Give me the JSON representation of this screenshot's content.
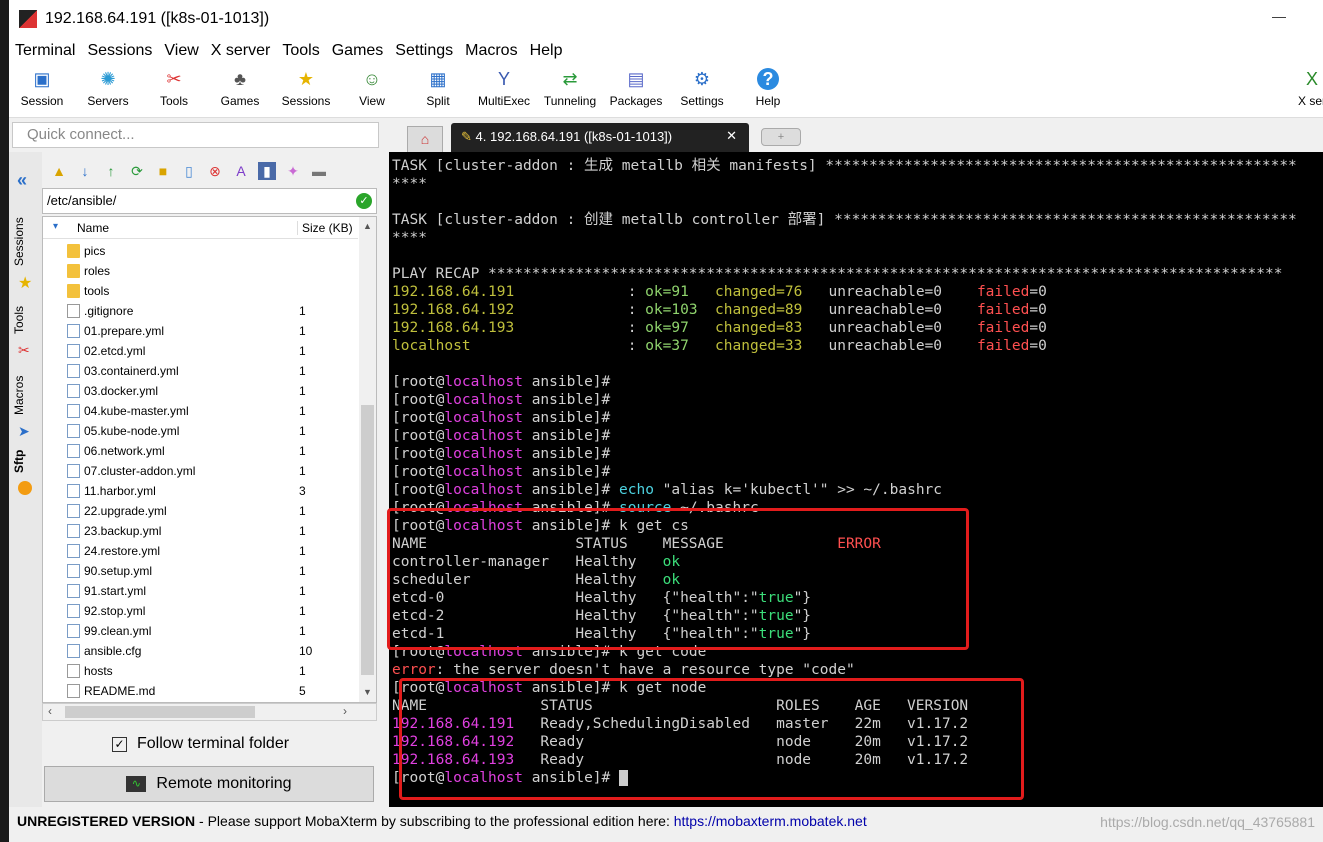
{
  "window": {
    "title": "192.168.64.191 ([k8s-01-1013])",
    "minimize": "—"
  },
  "menu": [
    "Terminal",
    "Sessions",
    "View",
    "X server",
    "Tools",
    "Games",
    "Settings",
    "Macros",
    "Help"
  ],
  "toolbar": [
    {
      "label": "Session",
      "icon": "session-icon"
    },
    {
      "label": "Servers",
      "icon": "servers-icon"
    },
    {
      "label": "Tools",
      "icon": "tools-icon"
    },
    {
      "label": "Games",
      "icon": "games-icon"
    },
    {
      "label": "Sessions",
      "icon": "star-icon"
    },
    {
      "label": "View",
      "icon": "view-icon"
    },
    {
      "label": "Split",
      "icon": "split-icon"
    },
    {
      "label": "MultiExec",
      "icon": "multiexec-icon"
    },
    {
      "label": "Tunneling",
      "icon": "tunneling-icon"
    },
    {
      "label": "Packages",
      "icon": "packages-icon"
    },
    {
      "label": "Settings",
      "icon": "settings-icon"
    },
    {
      "label": "Help",
      "icon": "help-icon"
    },
    {
      "label": "X ser",
      "icon": "xserver-icon"
    }
  ],
  "quick_connect": {
    "placeholder": "Quick connect..."
  },
  "tabs": {
    "active": "4. 192.168.64.191 ([k8s-01-1013])"
  },
  "side_tabs": [
    "Sessions",
    "Tools",
    "Macros",
    "Sftp"
  ],
  "sftp": {
    "path": "/etc/ansible/",
    "col_name": "Name",
    "col_size": "Size (KB)",
    "files": [
      {
        "name": "pics",
        "size": "",
        "type": "folder"
      },
      {
        "name": "roles",
        "size": "",
        "type": "folder"
      },
      {
        "name": "tools",
        "size": "",
        "type": "folder"
      },
      {
        "name": ".gitignore",
        "size": "1",
        "type": "file"
      },
      {
        "name": "01.prepare.yml",
        "size": "1",
        "type": "yml"
      },
      {
        "name": "02.etcd.yml",
        "size": "1",
        "type": "yml"
      },
      {
        "name": "03.containerd.yml",
        "size": "1",
        "type": "yml"
      },
      {
        "name": "03.docker.yml",
        "size": "1",
        "type": "yml"
      },
      {
        "name": "04.kube-master.yml",
        "size": "1",
        "type": "yml"
      },
      {
        "name": "05.kube-node.yml",
        "size": "1",
        "type": "yml"
      },
      {
        "name": "06.network.yml",
        "size": "1",
        "type": "yml"
      },
      {
        "name": "07.cluster-addon.yml",
        "size": "1",
        "type": "yml"
      },
      {
        "name": "11.harbor.yml",
        "size": "3",
        "type": "yml"
      },
      {
        "name": "22.upgrade.yml",
        "size": "1",
        "type": "yml"
      },
      {
        "name": "23.backup.yml",
        "size": "1",
        "type": "yml"
      },
      {
        "name": "24.restore.yml",
        "size": "1",
        "type": "yml"
      },
      {
        "name": "90.setup.yml",
        "size": "1",
        "type": "yml"
      },
      {
        "name": "91.start.yml",
        "size": "1",
        "type": "yml"
      },
      {
        "name": "92.stop.yml",
        "size": "1",
        "type": "yml"
      },
      {
        "name": "99.clean.yml",
        "size": "1",
        "type": "yml"
      },
      {
        "name": "ansible.cfg",
        "size": "10",
        "type": "yml"
      },
      {
        "name": "hosts",
        "size": "1",
        "type": "file"
      },
      {
        "name": "README.md",
        "size": "5",
        "type": "file"
      }
    ],
    "follow_label": "Follow terminal folder",
    "remote_label": "Remote monitoring"
  },
  "terminal": {
    "lines": [
      [
        {
          "t": "TASK [cluster-addon : 生成 metallb 相关 manifests] ******************************************************"
        }
      ],
      [
        {
          "t": "****"
        }
      ],
      [
        {
          "t": ""
        }
      ],
      [
        {
          "t": "TASK [cluster-addon : 创建 metallb controller 部署] *****************************************************"
        }
      ],
      [
        {
          "t": "****"
        }
      ],
      [
        {
          "t": ""
        }
      ],
      [
        {
          "t": "PLAY RECAP *******************************************************************************************"
        }
      ],
      [
        {
          "t": "192.168.64.191",
          "c": "gy"
        },
        {
          "t": "             : "
        },
        {
          "t": "ok=91",
          "c": "g"
        },
        {
          "t": "   "
        },
        {
          "t": "changed=76",
          "c": "gy"
        },
        {
          "t": "   unreachable=0    "
        },
        {
          "t": "failed",
          "c": "r"
        },
        {
          "t": "=0"
        }
      ],
      [
        {
          "t": "192.168.64.192",
          "c": "gy"
        },
        {
          "t": "             : "
        },
        {
          "t": "ok=103",
          "c": "g"
        },
        {
          "t": "  "
        },
        {
          "t": "changed=89",
          "c": "gy"
        },
        {
          "t": "   unreachable=0    "
        },
        {
          "t": "failed",
          "c": "r"
        },
        {
          "t": "=0"
        }
      ],
      [
        {
          "t": "192.168.64.193",
          "c": "gy"
        },
        {
          "t": "             : "
        },
        {
          "t": "ok=97",
          "c": "g"
        },
        {
          "t": "   "
        },
        {
          "t": "changed=83",
          "c": "gy"
        },
        {
          "t": "   unreachable=0    "
        },
        {
          "t": "failed",
          "c": "r"
        },
        {
          "t": "=0"
        }
      ],
      [
        {
          "t": "localhost",
          "c": "gy"
        },
        {
          "t": "                  : "
        },
        {
          "t": "ok=37",
          "c": "g"
        },
        {
          "t": "   "
        },
        {
          "t": "changed=33",
          "c": "gy"
        },
        {
          "t": "   unreachable=0    "
        },
        {
          "t": "failed",
          "c": "r"
        },
        {
          "t": "=0"
        }
      ],
      [
        {
          "t": ""
        }
      ],
      [
        {
          "t": "[root@"
        },
        {
          "t": "localhost",
          "c": "m"
        },
        {
          "t": " ansible]#"
        }
      ],
      [
        {
          "t": "[root@"
        },
        {
          "t": "localhost",
          "c": "m"
        },
        {
          "t": " ansible]#"
        }
      ],
      [
        {
          "t": "[root@"
        },
        {
          "t": "localhost",
          "c": "m"
        },
        {
          "t": " ansible]#"
        }
      ],
      [
        {
          "t": "[root@"
        },
        {
          "t": "localhost",
          "c": "m"
        },
        {
          "t": " ansible]#"
        }
      ],
      [
        {
          "t": "[root@"
        },
        {
          "t": "localhost",
          "c": "m"
        },
        {
          "t": " ansible]#"
        }
      ],
      [
        {
          "t": "[root@"
        },
        {
          "t": "localhost",
          "c": "m"
        },
        {
          "t": " ansible]#"
        }
      ],
      [
        {
          "t": "[root@"
        },
        {
          "t": "localhost",
          "c": "m"
        },
        {
          "t": " ansible]# "
        },
        {
          "t": "echo",
          "c": "c"
        },
        {
          "t": " \"alias k='kubectl'\" >> ~/.bashrc"
        }
      ],
      [
        {
          "t": "[root@"
        },
        {
          "t": "localhost",
          "c": "m"
        },
        {
          "t": " ansible]# "
        },
        {
          "t": "source",
          "c": "c"
        },
        {
          "t": " ~/.bashrc"
        }
      ],
      [
        {
          "t": "[root@"
        },
        {
          "t": "localhost",
          "c": "m"
        },
        {
          "t": " ansible]# k get cs"
        }
      ],
      [
        {
          "t": "NAME                 STATUS    MESSAGE             "
        },
        {
          "t": "ERROR",
          "c": "r"
        }
      ],
      [
        {
          "t": "controller-manager   Healthy   "
        },
        {
          "t": "ok",
          "c": "gr"
        }
      ],
      [
        {
          "t": "scheduler            Healthy   "
        },
        {
          "t": "ok",
          "c": "gr"
        }
      ],
      [
        {
          "t": "etcd-0               Healthy   {\"health\":\""
        },
        {
          "t": "true",
          "c": "gr"
        },
        {
          "t": "\"}"
        }
      ],
      [
        {
          "t": "etcd-2               Healthy   {\"health\":\""
        },
        {
          "t": "true",
          "c": "gr"
        },
        {
          "t": "\"}"
        }
      ],
      [
        {
          "t": "etcd-1               Healthy   {\"health\":\""
        },
        {
          "t": "true",
          "c": "gr"
        },
        {
          "t": "\"}"
        }
      ],
      [
        {
          "t": "[root@"
        },
        {
          "t": "localhost",
          "c": "m"
        },
        {
          "t": " ansible]# k get code"
        }
      ],
      [
        {
          "t": "error",
          "c": "r"
        },
        {
          "t": ": the server doesn't have a resource type \"code\""
        }
      ],
      [
        {
          "t": "[root@"
        },
        {
          "t": "localhost",
          "c": "m"
        },
        {
          "t": " ansible]# k get node"
        }
      ],
      [
        {
          "t": "NAME             STATUS                     ROLES    AGE   VERSION"
        }
      ],
      [
        {
          "t": "192.168.64.191",
          "c": "m"
        },
        {
          "t": "   Ready,SchedulingDisabled   master   22m   v1.17.2"
        }
      ],
      [
        {
          "t": "192.168.64.192",
          "c": "m"
        },
        {
          "t": "   Ready                      node     20m   v1.17.2"
        }
      ],
      [
        {
          "t": "192.168.64.193",
          "c": "m"
        },
        {
          "t": "   Ready                      node     20m   v1.17.2"
        }
      ],
      [
        {
          "t": "[root@"
        },
        {
          "t": "localhost",
          "c": "m"
        },
        {
          "t": " ansible]# "
        },
        {
          "t": "",
          "cursor": true
        }
      ]
    ]
  },
  "status": {
    "unregistered": "UNREGISTERED VERSION",
    "message": " -  Please support MobaXterm by subscribing to the professional edition here:  ",
    "link": "https://mobaxterm.mobatek.net",
    "watermark": "https://blog.csdn.net/qq_43765881"
  }
}
